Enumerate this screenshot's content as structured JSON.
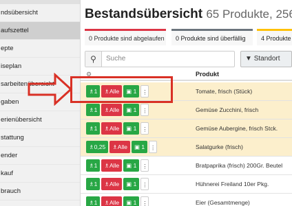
{
  "sidebar": {
    "items": [
      {
        "label": "ndsübersicht",
        "active": false
      },
      {
        "label": "aufszettel",
        "active": true
      },
      {
        "label": "epte",
        "active": false
      },
      {
        "label": "iseplan",
        "active": false
      },
      {
        "label": "sarbeitenübersicht",
        "active": false
      },
      {
        "label": "gaben",
        "active": false
      },
      {
        "label": "erienübersicht",
        "active": false
      },
      {
        "label": "stattung",
        "active": false
      },
      {
        "label": "ender",
        "active": false
      },
      {
        "label": "kauf",
        "active": false
      },
      {
        "label": "brauch",
        "active": false
      }
    ]
  },
  "header": {
    "title": "Bestandsübersicht",
    "subtitle": "65 Produkte, 256"
  },
  "tiles": {
    "expired": "0 Produkte sind abgelaufen",
    "overdue": "0 Produkte sind überfällig",
    "due": "4 Produkte s"
  },
  "search": {
    "placeholder": "Suche"
  },
  "location_filter": {
    "label": "Standort"
  },
  "table": {
    "column_product": "Produkt",
    "rows": [
      {
        "consume": "1",
        "consume_all": "Alle",
        "open": "1",
        "product": "Tomate, frisch (Stück)",
        "highlight": true
      },
      {
        "consume": "1",
        "consume_all": "Alle",
        "open": "1",
        "product": "Gemüse Zucchini, frisch",
        "highlight": true
      },
      {
        "consume": "1",
        "consume_all": "Alle",
        "open": "1",
        "product": "Gemüse Aubergine, frisch Stck.",
        "highlight": true
      },
      {
        "consume": "0,25",
        "consume_all": "Alle",
        "open": "1",
        "product": "Salatgurke (frisch)",
        "highlight": true
      },
      {
        "consume": "1",
        "consume_all": "Alle",
        "open": "1",
        "product": "Bratpaprika (frisch) 200Gr. Beutel",
        "highlight": false
      },
      {
        "consume": "1",
        "consume_all": "Alle",
        "open": "1",
        "product": "Hühnerei Freiland 10er Pkg.",
        "highlight": false
      },
      {
        "consume": "1",
        "consume_all": "Alle",
        "open": "1",
        "product": "Eier (Gesamtmenge)",
        "highlight": false
      }
    ]
  },
  "colors": {
    "green": "#28a745",
    "red": "#dc3545",
    "row_highlight": "#fcefcc",
    "annotation": "#d93025"
  }
}
